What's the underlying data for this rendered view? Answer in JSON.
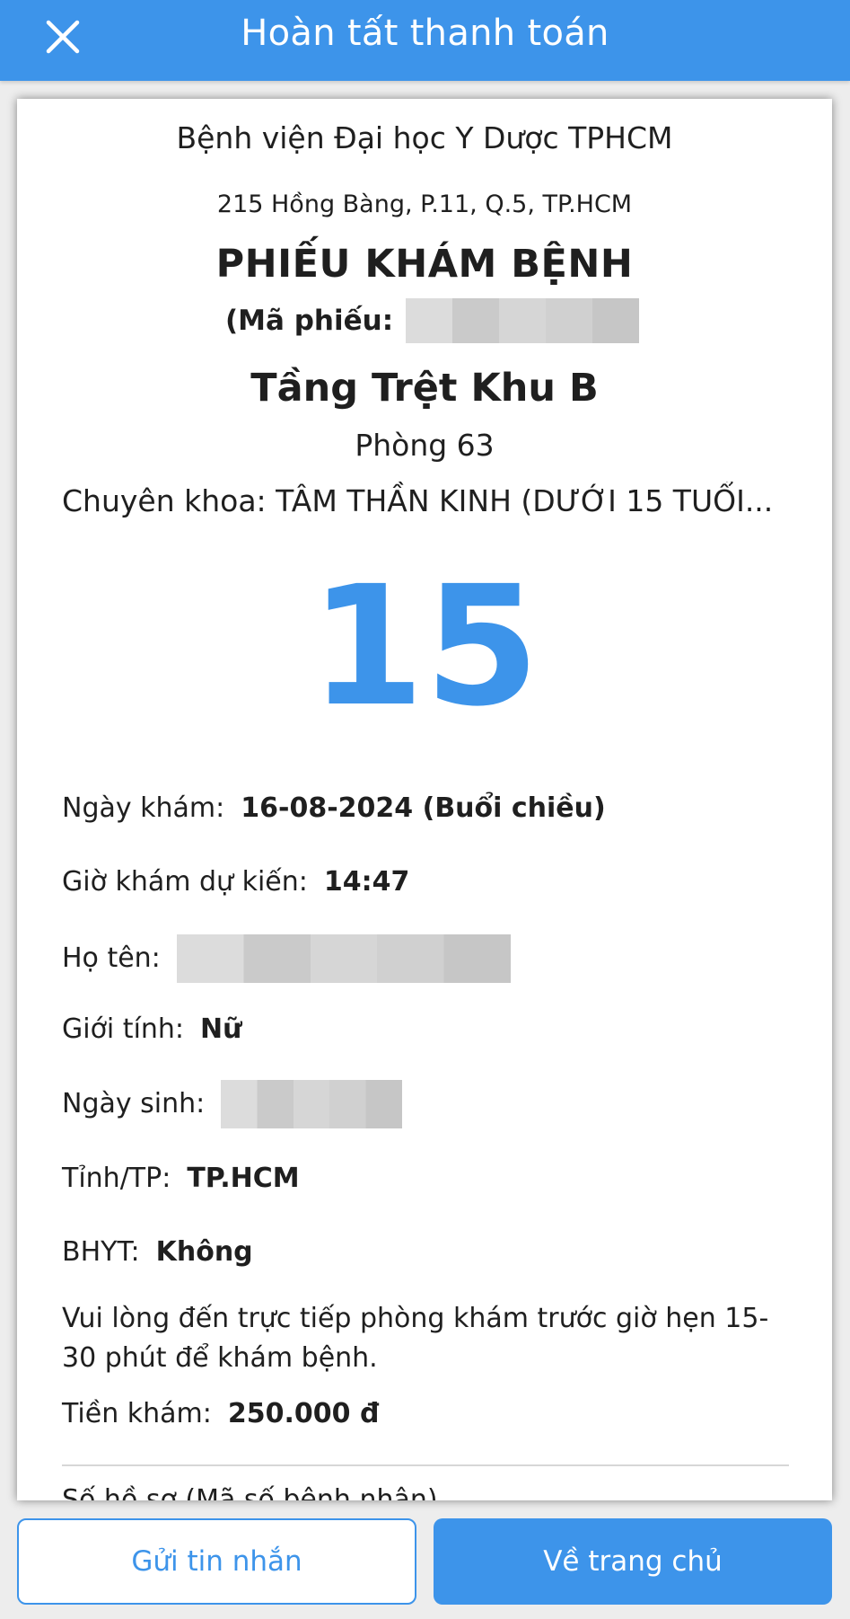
{
  "header": {
    "title": "Hoàn tất thanh toán",
    "close_icon": "close-icon"
  },
  "ticket": {
    "hospital_name": "Bệnh viện Đại học Y Dược TPHCM",
    "hospital_address": "215 Hồng Bàng, P.11, Q.5, TP.HCM",
    "title": "PHIẾU KHÁM BỆNH",
    "code_label": "(Mã phiếu:",
    "floor": "Tầng Trệt Khu B",
    "room": "Phòng 63",
    "specialty": "Chuyên khoa: TÂM THẦN KINH (DƯỚI 15 TUỔI...",
    "queue_number": "15",
    "date_label": "Ngày khám:",
    "date_value": "16-08-2024 (Buổi chiều)",
    "time_label": "Giờ khám dự kiến:",
    "time_value": "14:47",
    "name_label": "Họ tên:",
    "gender_label": "Giới tính:",
    "gender_value": "Nữ",
    "dob_label": "Ngày sinh:",
    "province_label": "Tỉnh/TP:",
    "province_value": "TP.HCM",
    "bhyt_label": "BHYT:",
    "bhyt_value": "Không",
    "notice": "Vui lòng đến trực tiếp phòng khám trước giờ hẹn 15-30 phút để khám bệnh.",
    "fee_label": "Tiền khám:",
    "fee_value": "250.000 đ",
    "cut_text": "Số hồ sơ (Mã số bệnh nhân)"
  },
  "actions": {
    "message_label": "Gửi tin nhắn",
    "home_label": "Về trang chủ"
  },
  "colors": {
    "accent": "#3d94ea",
    "background": "#ededed",
    "card": "#ffffff"
  }
}
